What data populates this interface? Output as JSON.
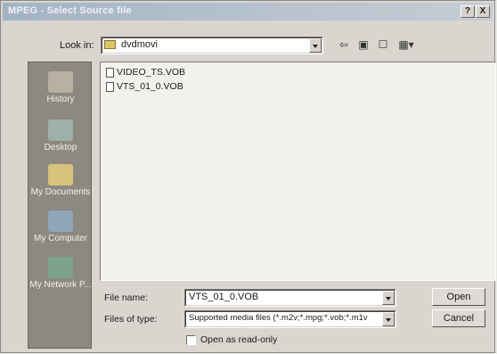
{
  "window": {
    "title": "MPEG - Select Source file",
    "help_label": "?",
    "close_label": "X"
  },
  "lookin": {
    "label": "Look in:",
    "value": "dvdmovi"
  },
  "toolbar": {
    "back_icon": "back-arrow-icon",
    "up_icon": "up-folder-icon",
    "newfolder_icon": "new-folder-icon",
    "views_icon": "views-menu-icon",
    "back_glyph": "⇦",
    "up_glyph": "▣",
    "newfolder_glyph": "☐",
    "views_glyph": "▦▾"
  },
  "places": [
    {
      "label": "History",
      "icon": "history-icon",
      "color": "#b6b1a0"
    },
    {
      "label": "Desktop",
      "icon": "desktop-icon",
      "color": "#9fb0a8"
    },
    {
      "label": "My Documents",
      "icon": "my-documents-icon",
      "color": "#d9c27a"
    },
    {
      "label": "My Computer",
      "icon": "my-computer-icon",
      "color": "#8fa6b8"
    },
    {
      "label": "My Network P...",
      "icon": "network-places-icon",
      "color": "#7da38f"
    }
  ],
  "files": [
    {
      "name": "VIDEO_TS.VOB"
    },
    {
      "name": "VTS_01_0.VOB"
    }
  ],
  "filename": {
    "label": "File name:",
    "value": "VTS_01_0.VOB"
  },
  "filetype": {
    "label": "Files of type:",
    "value": "Supported media files (*.m2v;*.mpg;*.vob;*.m1v"
  },
  "buttons": {
    "open": "Open",
    "cancel": "Cancel"
  },
  "readonly": {
    "label": "Open as read-only",
    "checked": false
  }
}
